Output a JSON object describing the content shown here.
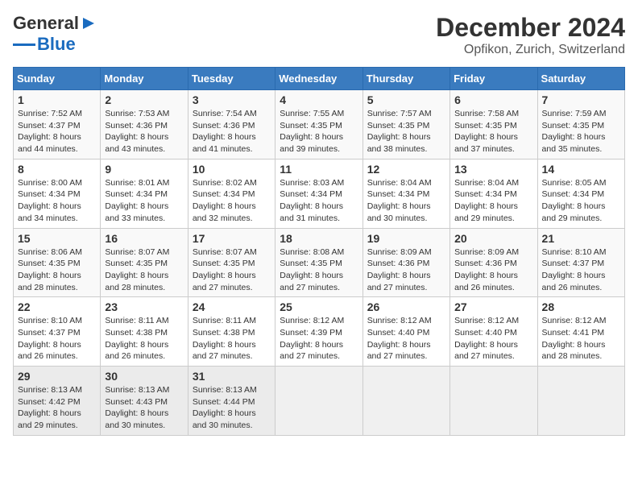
{
  "header": {
    "logo_general": "General",
    "logo_blue": "Blue",
    "month_title": "December 2024",
    "location": "Opfikon, Zurich, Switzerland"
  },
  "weekdays": [
    "Sunday",
    "Monday",
    "Tuesday",
    "Wednesday",
    "Thursday",
    "Friday",
    "Saturday"
  ],
  "weeks": [
    [
      {
        "day": "1",
        "sunrise": "Sunrise: 7:52 AM",
        "sunset": "Sunset: 4:37 PM",
        "daylight": "Daylight: 8 hours and 44 minutes."
      },
      {
        "day": "2",
        "sunrise": "Sunrise: 7:53 AM",
        "sunset": "Sunset: 4:36 PM",
        "daylight": "Daylight: 8 hours and 43 minutes."
      },
      {
        "day": "3",
        "sunrise": "Sunrise: 7:54 AM",
        "sunset": "Sunset: 4:36 PM",
        "daylight": "Daylight: 8 hours and 41 minutes."
      },
      {
        "day": "4",
        "sunrise": "Sunrise: 7:55 AM",
        "sunset": "Sunset: 4:35 PM",
        "daylight": "Daylight: 8 hours and 39 minutes."
      },
      {
        "day": "5",
        "sunrise": "Sunrise: 7:57 AM",
        "sunset": "Sunset: 4:35 PM",
        "daylight": "Daylight: 8 hours and 38 minutes."
      },
      {
        "day": "6",
        "sunrise": "Sunrise: 7:58 AM",
        "sunset": "Sunset: 4:35 PM",
        "daylight": "Daylight: 8 hours and 37 minutes."
      },
      {
        "day": "7",
        "sunrise": "Sunrise: 7:59 AM",
        "sunset": "Sunset: 4:35 PM",
        "daylight": "Daylight: 8 hours and 35 minutes."
      }
    ],
    [
      {
        "day": "8",
        "sunrise": "Sunrise: 8:00 AM",
        "sunset": "Sunset: 4:34 PM",
        "daylight": "Daylight: 8 hours and 34 minutes."
      },
      {
        "day": "9",
        "sunrise": "Sunrise: 8:01 AM",
        "sunset": "Sunset: 4:34 PM",
        "daylight": "Daylight: 8 hours and 33 minutes."
      },
      {
        "day": "10",
        "sunrise": "Sunrise: 8:02 AM",
        "sunset": "Sunset: 4:34 PM",
        "daylight": "Daylight: 8 hours and 32 minutes."
      },
      {
        "day": "11",
        "sunrise": "Sunrise: 8:03 AM",
        "sunset": "Sunset: 4:34 PM",
        "daylight": "Daylight: 8 hours and 31 minutes."
      },
      {
        "day": "12",
        "sunrise": "Sunrise: 8:04 AM",
        "sunset": "Sunset: 4:34 PM",
        "daylight": "Daylight: 8 hours and 30 minutes."
      },
      {
        "day": "13",
        "sunrise": "Sunrise: 8:04 AM",
        "sunset": "Sunset: 4:34 PM",
        "daylight": "Daylight: 8 hours and 29 minutes."
      },
      {
        "day": "14",
        "sunrise": "Sunrise: 8:05 AM",
        "sunset": "Sunset: 4:34 PM",
        "daylight": "Daylight: 8 hours and 29 minutes."
      }
    ],
    [
      {
        "day": "15",
        "sunrise": "Sunrise: 8:06 AM",
        "sunset": "Sunset: 4:35 PM",
        "daylight": "Daylight: 8 hours and 28 minutes."
      },
      {
        "day": "16",
        "sunrise": "Sunrise: 8:07 AM",
        "sunset": "Sunset: 4:35 PM",
        "daylight": "Daylight: 8 hours and 28 minutes."
      },
      {
        "day": "17",
        "sunrise": "Sunrise: 8:07 AM",
        "sunset": "Sunset: 4:35 PM",
        "daylight": "Daylight: 8 hours and 27 minutes."
      },
      {
        "day": "18",
        "sunrise": "Sunrise: 8:08 AM",
        "sunset": "Sunset: 4:35 PM",
        "daylight": "Daylight: 8 hours and 27 minutes."
      },
      {
        "day": "19",
        "sunrise": "Sunrise: 8:09 AM",
        "sunset": "Sunset: 4:36 PM",
        "daylight": "Daylight: 8 hours and 27 minutes."
      },
      {
        "day": "20",
        "sunrise": "Sunrise: 8:09 AM",
        "sunset": "Sunset: 4:36 PM",
        "daylight": "Daylight: 8 hours and 26 minutes."
      },
      {
        "day": "21",
        "sunrise": "Sunrise: 8:10 AM",
        "sunset": "Sunset: 4:37 PM",
        "daylight": "Daylight: 8 hours and 26 minutes."
      }
    ],
    [
      {
        "day": "22",
        "sunrise": "Sunrise: 8:10 AM",
        "sunset": "Sunset: 4:37 PM",
        "daylight": "Daylight: 8 hours and 26 minutes."
      },
      {
        "day": "23",
        "sunrise": "Sunrise: 8:11 AM",
        "sunset": "Sunset: 4:38 PM",
        "daylight": "Daylight: 8 hours and 26 minutes."
      },
      {
        "day": "24",
        "sunrise": "Sunrise: 8:11 AM",
        "sunset": "Sunset: 4:38 PM",
        "daylight": "Daylight: 8 hours and 27 minutes."
      },
      {
        "day": "25",
        "sunrise": "Sunrise: 8:12 AM",
        "sunset": "Sunset: 4:39 PM",
        "daylight": "Daylight: 8 hours and 27 minutes."
      },
      {
        "day": "26",
        "sunrise": "Sunrise: 8:12 AM",
        "sunset": "Sunset: 4:40 PM",
        "daylight": "Daylight: 8 hours and 27 minutes."
      },
      {
        "day": "27",
        "sunrise": "Sunrise: 8:12 AM",
        "sunset": "Sunset: 4:40 PM",
        "daylight": "Daylight: 8 hours and 27 minutes."
      },
      {
        "day": "28",
        "sunrise": "Sunrise: 8:12 AM",
        "sunset": "Sunset: 4:41 PM",
        "daylight": "Daylight: 8 hours and 28 minutes."
      }
    ],
    [
      {
        "day": "29",
        "sunrise": "Sunrise: 8:13 AM",
        "sunset": "Sunset: 4:42 PM",
        "daylight": "Daylight: 8 hours and 29 minutes."
      },
      {
        "day": "30",
        "sunrise": "Sunrise: 8:13 AM",
        "sunset": "Sunset: 4:43 PM",
        "daylight": "Daylight: 8 hours and 30 minutes."
      },
      {
        "day": "31",
        "sunrise": "Sunrise: 8:13 AM",
        "sunset": "Sunset: 4:44 PM",
        "daylight": "Daylight: 8 hours and 30 minutes."
      },
      null,
      null,
      null,
      null
    ]
  ]
}
